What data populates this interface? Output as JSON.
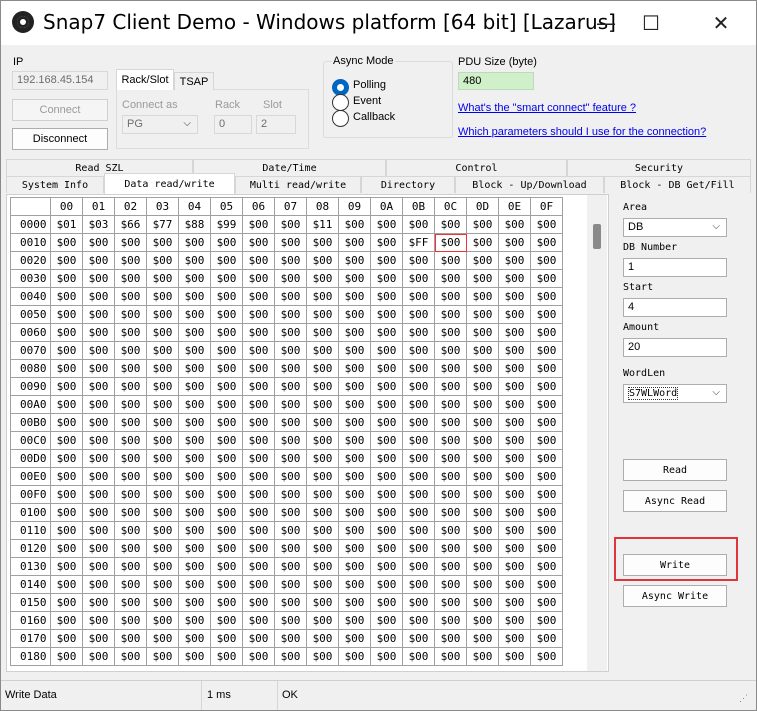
{
  "window": {
    "title": "Snap7 Client Demo - Windows platform [64 bit] [Lazarus]",
    "minimize": "—",
    "maximize": "☐",
    "close": "✕"
  },
  "connection": {
    "ip_label": "IP",
    "ip_value": "192.168.45.154",
    "connect_label": "Connect",
    "disconnect_label": "Disconnect",
    "tabs": [
      "Rack/Slot",
      "TSAP"
    ],
    "connect_as_label": "Connect as",
    "connect_as_value": "PG",
    "rack_label": "Rack",
    "rack_value": "0",
    "slot_label": "Slot",
    "slot_value": "2"
  },
  "async_mode": {
    "label": "Async Mode",
    "options": [
      "Polling",
      "Event",
      "Callback"
    ],
    "selected": "Polling"
  },
  "pdu": {
    "label": "PDU Size (byte)",
    "value": "480",
    "link1": "What's the \"smart connect\" feature ?",
    "link2": "Which parameters should I use for the connection?"
  },
  "tabs_row1": [
    "Read SZL",
    "Date/Time",
    "Control",
    "Security"
  ],
  "tabs_row2": [
    "System Info",
    "Data read/write",
    "Multi read/write",
    "Directory",
    "Block - Up/Download",
    "Block - DB Get/Fill"
  ],
  "active_tab": "Data read/write",
  "grid": {
    "columns": [
      "00",
      "01",
      "02",
      "03",
      "04",
      "05",
      "06",
      "07",
      "08",
      "09",
      "0A",
      "0B",
      "0C",
      "0D",
      "0E",
      "0F"
    ],
    "rows": [
      {
        "addr": "0000",
        "values": [
          "$01",
          "$03",
          "$66",
          "$77",
          "$88",
          "$99",
          "$00",
          "$00",
          "$11",
          "$00",
          "$00",
          "$00",
          "$00",
          "$00",
          "$00",
          "$00"
        ]
      },
      {
        "addr": "0010",
        "values": [
          "$00",
          "$00",
          "$00",
          "$00",
          "$00",
          "$00",
          "$00",
          "$00",
          "$00",
          "$00",
          "$00",
          "$FF",
          "$00",
          "$00",
          "$00",
          "$00"
        ]
      },
      {
        "addr": "0020",
        "values": [
          "$00",
          "$00",
          "$00",
          "$00",
          "$00",
          "$00",
          "$00",
          "$00",
          "$00",
          "$00",
          "$00",
          "$00",
          "$00",
          "$00",
          "$00",
          "$00"
        ]
      },
      {
        "addr": "0030",
        "values": [
          "$00",
          "$00",
          "$00",
          "$00",
          "$00",
          "$00",
          "$00",
          "$00",
          "$00",
          "$00",
          "$00",
          "$00",
          "$00",
          "$00",
          "$00",
          "$00"
        ]
      },
      {
        "addr": "0040",
        "values": [
          "$00",
          "$00",
          "$00",
          "$00",
          "$00",
          "$00",
          "$00",
          "$00",
          "$00",
          "$00",
          "$00",
          "$00",
          "$00",
          "$00",
          "$00",
          "$00"
        ]
      },
      {
        "addr": "0050",
        "values": [
          "$00",
          "$00",
          "$00",
          "$00",
          "$00",
          "$00",
          "$00",
          "$00",
          "$00",
          "$00",
          "$00",
          "$00",
          "$00",
          "$00",
          "$00",
          "$00"
        ]
      },
      {
        "addr": "0060",
        "values": [
          "$00",
          "$00",
          "$00",
          "$00",
          "$00",
          "$00",
          "$00",
          "$00",
          "$00",
          "$00",
          "$00",
          "$00",
          "$00",
          "$00",
          "$00",
          "$00"
        ]
      },
      {
        "addr": "0070",
        "values": [
          "$00",
          "$00",
          "$00",
          "$00",
          "$00",
          "$00",
          "$00",
          "$00",
          "$00",
          "$00",
          "$00",
          "$00",
          "$00",
          "$00",
          "$00",
          "$00"
        ]
      },
      {
        "addr": "0080",
        "values": [
          "$00",
          "$00",
          "$00",
          "$00",
          "$00",
          "$00",
          "$00",
          "$00",
          "$00",
          "$00",
          "$00",
          "$00",
          "$00",
          "$00",
          "$00",
          "$00"
        ]
      },
      {
        "addr": "0090",
        "values": [
          "$00",
          "$00",
          "$00",
          "$00",
          "$00",
          "$00",
          "$00",
          "$00",
          "$00",
          "$00",
          "$00",
          "$00",
          "$00",
          "$00",
          "$00",
          "$00"
        ]
      },
      {
        "addr": "00A0",
        "values": [
          "$00",
          "$00",
          "$00",
          "$00",
          "$00",
          "$00",
          "$00",
          "$00",
          "$00",
          "$00",
          "$00",
          "$00",
          "$00",
          "$00",
          "$00",
          "$00"
        ]
      },
      {
        "addr": "00B0",
        "values": [
          "$00",
          "$00",
          "$00",
          "$00",
          "$00",
          "$00",
          "$00",
          "$00",
          "$00",
          "$00",
          "$00",
          "$00",
          "$00",
          "$00",
          "$00",
          "$00"
        ]
      },
      {
        "addr": "00C0",
        "values": [
          "$00",
          "$00",
          "$00",
          "$00",
          "$00",
          "$00",
          "$00",
          "$00",
          "$00",
          "$00",
          "$00",
          "$00",
          "$00",
          "$00",
          "$00",
          "$00"
        ]
      },
      {
        "addr": "00D0",
        "values": [
          "$00",
          "$00",
          "$00",
          "$00",
          "$00",
          "$00",
          "$00",
          "$00",
          "$00",
          "$00",
          "$00",
          "$00",
          "$00",
          "$00",
          "$00",
          "$00"
        ]
      },
      {
        "addr": "00E0",
        "values": [
          "$00",
          "$00",
          "$00",
          "$00",
          "$00",
          "$00",
          "$00",
          "$00",
          "$00",
          "$00",
          "$00",
          "$00",
          "$00",
          "$00",
          "$00",
          "$00"
        ]
      },
      {
        "addr": "00F0",
        "values": [
          "$00",
          "$00",
          "$00",
          "$00",
          "$00",
          "$00",
          "$00",
          "$00",
          "$00",
          "$00",
          "$00",
          "$00",
          "$00",
          "$00",
          "$00",
          "$00"
        ]
      },
      {
        "addr": "0100",
        "values": [
          "$00",
          "$00",
          "$00",
          "$00",
          "$00",
          "$00",
          "$00",
          "$00",
          "$00",
          "$00",
          "$00",
          "$00",
          "$00",
          "$00",
          "$00",
          "$00"
        ]
      },
      {
        "addr": "0110",
        "values": [
          "$00",
          "$00",
          "$00",
          "$00",
          "$00",
          "$00",
          "$00",
          "$00",
          "$00",
          "$00",
          "$00",
          "$00",
          "$00",
          "$00",
          "$00",
          "$00"
        ]
      },
      {
        "addr": "0120",
        "values": [
          "$00",
          "$00",
          "$00",
          "$00",
          "$00",
          "$00",
          "$00",
          "$00",
          "$00",
          "$00",
          "$00",
          "$00",
          "$00",
          "$00",
          "$00",
          "$00"
        ]
      },
      {
        "addr": "0130",
        "values": [
          "$00",
          "$00",
          "$00",
          "$00",
          "$00",
          "$00",
          "$00",
          "$00",
          "$00",
          "$00",
          "$00",
          "$00",
          "$00",
          "$00",
          "$00",
          "$00"
        ]
      },
      {
        "addr": "0140",
        "values": [
          "$00",
          "$00",
          "$00",
          "$00",
          "$00",
          "$00",
          "$00",
          "$00",
          "$00",
          "$00",
          "$00",
          "$00",
          "$00",
          "$00",
          "$00",
          "$00"
        ]
      },
      {
        "addr": "0150",
        "values": [
          "$00",
          "$00",
          "$00",
          "$00",
          "$00",
          "$00",
          "$00",
          "$00",
          "$00",
          "$00",
          "$00",
          "$00",
          "$00",
          "$00",
          "$00",
          "$00"
        ]
      },
      {
        "addr": "0160",
        "values": [
          "$00",
          "$00",
          "$00",
          "$00",
          "$00",
          "$00",
          "$00",
          "$00",
          "$00",
          "$00",
          "$00",
          "$00",
          "$00",
          "$00",
          "$00",
          "$00"
        ]
      },
      {
        "addr": "0170",
        "values": [
          "$00",
          "$00",
          "$00",
          "$00",
          "$00",
          "$00",
          "$00",
          "$00",
          "$00",
          "$00",
          "$00",
          "$00",
          "$00",
          "$00",
          "$00",
          "$00"
        ]
      },
      {
        "addr": "0180",
        "values": [
          "$00",
          "$00",
          "$00",
          "$00",
          "$00",
          "$00",
          "$00",
          "$00",
          "$00",
          "$00",
          "$00",
          "$00",
          "$00",
          "$00",
          "$00",
          "$00"
        ]
      }
    ],
    "selected_cell": {
      "row": 1,
      "col": 12
    }
  },
  "right_panel": {
    "area_label": "Area",
    "area_value": "DB",
    "db_number_label": "DB Number",
    "db_number_value": "1",
    "start_label": "Start",
    "start_value": "4",
    "amount_label": "Amount",
    "amount_value": "20",
    "wordlen_label": "WordLen",
    "wordlen_value": "S7WLWord",
    "read_label": "Read",
    "async_read_label": "Async Read",
    "write_label": "Write",
    "async_write_label": "Async Write"
  },
  "status": {
    "op": "Write Data",
    "time": "1 ms",
    "result": "OK"
  }
}
